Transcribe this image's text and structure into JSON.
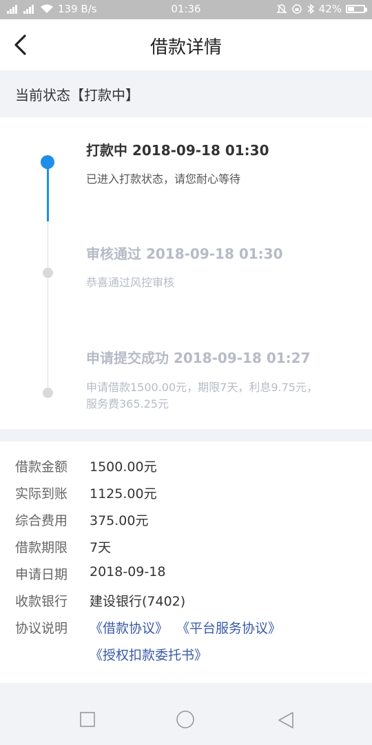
{
  "status_bar": {
    "network": "4G",
    "speed": "139 B/s",
    "time": "01:36",
    "battery": "42%",
    "battery_level": 0.42
  },
  "header": {
    "title": "借款详情",
    "back_icon": "back-arrow-icon"
  },
  "current_status": {
    "text": "当前状态【打款中】"
  },
  "timeline": {
    "steps": [
      {
        "title": "打款中 2018-09-18 01:30",
        "desc": "已进入打款状态，请您耐心等待",
        "state": "active"
      },
      {
        "title": "审核通过 2018-09-18 01:30",
        "desc": "恭喜通过风控审核",
        "state": "done"
      },
      {
        "title": "申请提交成功 2018-09-18 01:27",
        "desc": "申请借款1500.00元，期限7天，利息9.75元，服务费365.25元",
        "state": "done"
      }
    ],
    "active_color": "#1e8fe8",
    "inactive_color": "#b7bbc7"
  },
  "details": {
    "rows": [
      {
        "label": "借款金额",
        "value": "1500.00元"
      },
      {
        "label": "实际到账",
        "value": "1125.00元"
      },
      {
        "label": "综合费用",
        "value": "375.00元"
      },
      {
        "label": "借款期限",
        "value": "7天"
      },
      {
        "label": "申请日期",
        "value": "2018-09-18"
      },
      {
        "label": "收款银行",
        "value": "建设银行(7402)"
      }
    ],
    "agreement_label": "协议说明",
    "agreements": [
      "《借款协议》",
      "《平台服务协议》",
      "《授权扣款委托书》"
    ],
    "link_color": "#3a5aa8"
  },
  "nav_bar": {
    "icons": [
      "recent-apps-icon",
      "home-icon",
      "back-triangle-icon"
    ]
  }
}
